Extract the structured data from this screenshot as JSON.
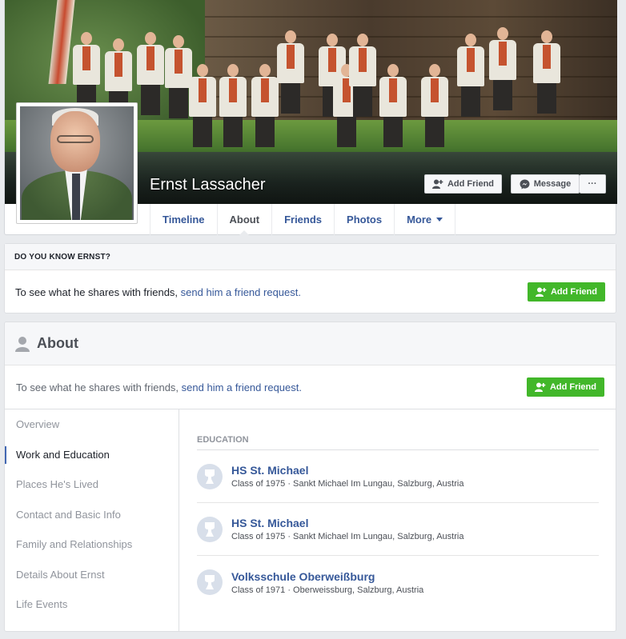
{
  "profile": {
    "name": "Ernst Lassacher"
  },
  "cover_actions": {
    "add_friend": "Add Friend",
    "message": "Message",
    "more": "···"
  },
  "tabs": [
    {
      "label": "Timeline"
    },
    {
      "label": "About"
    },
    {
      "label": "Friends"
    },
    {
      "label": "Photos"
    },
    {
      "label": "More"
    }
  ],
  "know_card": {
    "header": "DO YOU KNOW ERNST?",
    "text": "To see what he shares with friends, ",
    "link": "send him a friend request.",
    "button": "Add Friend"
  },
  "about": {
    "title": "About",
    "info_text": "To see what he shares with friends, ",
    "info_link": "send him a friend request.",
    "button": "Add Friend",
    "nav": [
      {
        "label": "Overview"
      },
      {
        "label": "Work and Education"
      },
      {
        "label": "Places He's Lived"
      },
      {
        "label": "Contact and Basic Info"
      },
      {
        "label": "Family and Relationships"
      },
      {
        "label": "Details About Ernst"
      },
      {
        "label": "Life Events"
      }
    ],
    "section_title": "EDUCATION",
    "education": [
      {
        "name": "HS St. Michael",
        "meta": "Class of 1975 · Sankt Michael Im Lungau, Salzburg, Austria"
      },
      {
        "name": "HS St. Michael",
        "meta": "Class of 1975 · Sankt Michael Im Lungau, Salzburg, Austria"
      },
      {
        "name": "Volksschule Oberweißburg",
        "meta": "Class of 1971 · Oberweissburg, Salzburg, Austria"
      }
    ]
  },
  "colors": {
    "link": "#365899",
    "green": "#42b72a",
    "page_bg": "#e9ebee"
  }
}
